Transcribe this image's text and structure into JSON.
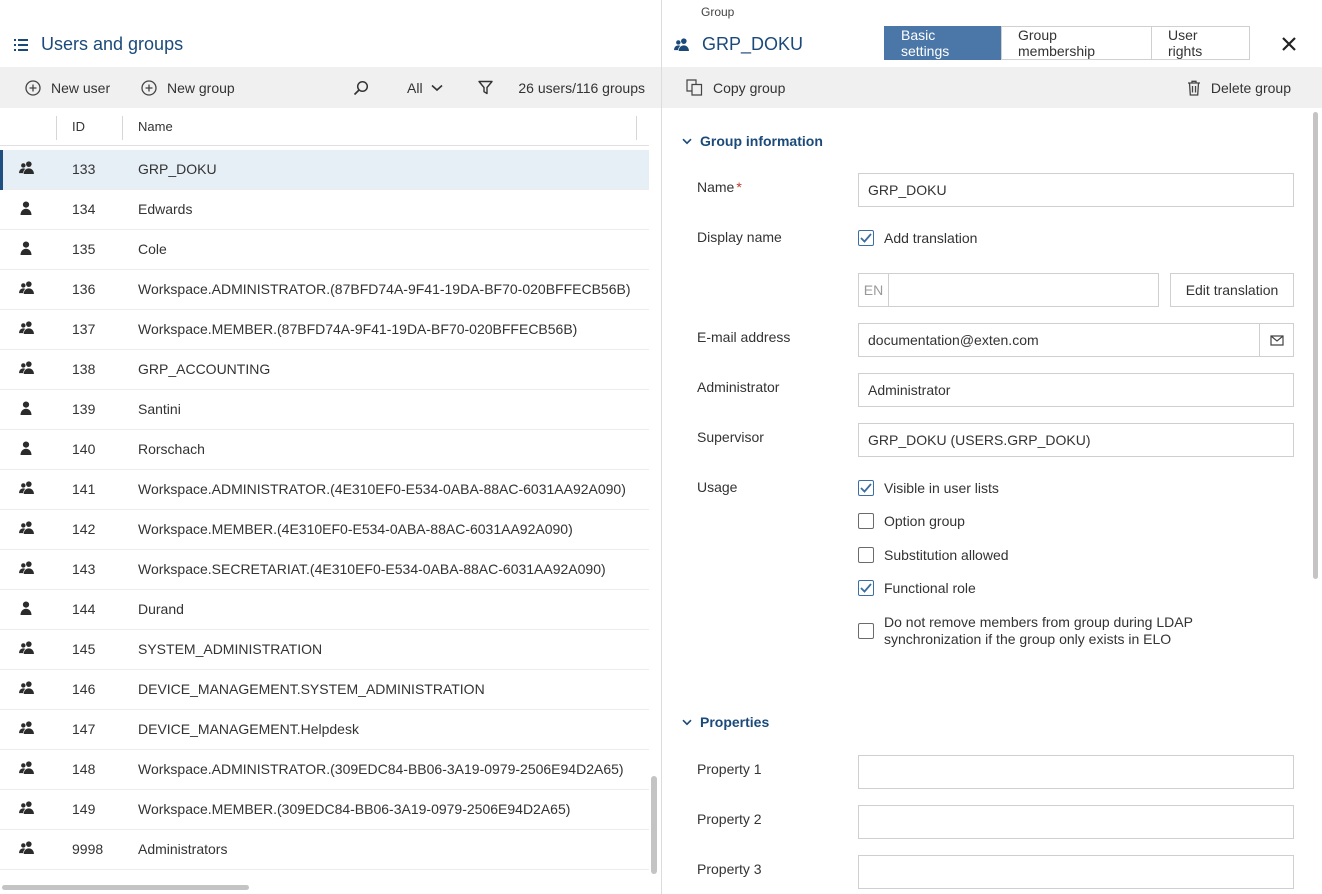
{
  "left": {
    "title": "Users and groups",
    "toolbar": {
      "new_user": "New user",
      "new_group": "New group",
      "filter_value": "All",
      "count": "26 users/116 groups"
    },
    "columns": {
      "id": "ID",
      "name": "Name"
    },
    "rows": [
      {
        "type": "group",
        "id": "133",
        "name": "GRP_DOKU",
        "selected": true
      },
      {
        "type": "user",
        "id": "134",
        "name": "Edwards"
      },
      {
        "type": "user",
        "id": "135",
        "name": "Cole"
      },
      {
        "type": "group",
        "id": "136",
        "name": "Workspace.ADMINISTRATOR.(87BFD74A-9F41-19DA-BF70-020BFFECB56B)"
      },
      {
        "type": "group",
        "id": "137",
        "name": "Workspace.MEMBER.(87BFD74A-9F41-19DA-BF70-020BFFECB56B)"
      },
      {
        "type": "group",
        "id": "138",
        "name": "GRP_ACCOUNTING"
      },
      {
        "type": "user",
        "id": "139",
        "name": "Santini"
      },
      {
        "type": "user",
        "id": "140",
        "name": "Rorschach"
      },
      {
        "type": "group",
        "id": "141",
        "name": "Workspace.ADMINISTRATOR.(4E310EF0-E534-0ABA-88AC-6031AA92A090)"
      },
      {
        "type": "group",
        "id": "142",
        "name": "Workspace.MEMBER.(4E310EF0-E534-0ABA-88AC-6031AA92A090)"
      },
      {
        "type": "group",
        "id": "143",
        "name": "Workspace.SECRETARIAT.(4E310EF0-E534-0ABA-88AC-6031AA92A090)"
      },
      {
        "type": "user",
        "id": "144",
        "name": "Durand"
      },
      {
        "type": "group",
        "id": "145",
        "name": "SYSTEM_ADMINISTRATION"
      },
      {
        "type": "group",
        "id": "146",
        "name": "DEVICE_MANAGEMENT.SYSTEM_ADMINISTRATION"
      },
      {
        "type": "group",
        "id": "147",
        "name": "DEVICE_MANAGEMENT.Helpdesk"
      },
      {
        "type": "group",
        "id": "148",
        "name": "Workspace.ADMINISTRATOR.(309EDC84-BB06-3A19-0979-2506E94D2A65)"
      },
      {
        "type": "group",
        "id": "149",
        "name": "Workspace.MEMBER.(309EDC84-BB06-3A19-0979-2506E94D2A65)"
      },
      {
        "type": "group",
        "id": "9998",
        "name": "Administrators"
      }
    ]
  },
  "right": {
    "subtitle": "Group",
    "title": "GRP_DOKU",
    "tabs": {
      "basic": "Basic settings",
      "membership": "Group membership",
      "rights": "User rights"
    },
    "toolbar": {
      "copy_group": "Copy group",
      "delete_group": "Delete group"
    },
    "group_info": {
      "heading": "Group information",
      "name_label": "Name",
      "required_mark": "*",
      "name_value": "GRP_DOKU",
      "display_name_label": "Display name",
      "add_translation": "Add translation",
      "lang_code": "EN",
      "edit_translation": "Edit translation",
      "email_label": "E-mail address",
      "email_value": "documentation@exten.com",
      "administrator_label": "Administrator",
      "administrator_value": "Administrator",
      "supervisor_label": "Supervisor",
      "supervisor_value": "GRP_DOKU (USERS.GRP_DOKU)",
      "usage_label": "Usage",
      "usage_options": {
        "visible": {
          "label": "Visible in user lists",
          "checked": true
        },
        "option_group": {
          "label": "Option group",
          "checked": false
        },
        "substitution": {
          "label": "Substitution allowed",
          "checked": false
        },
        "functional_role": {
          "label": "Functional role",
          "checked": true
        },
        "ldap_line1": "Do not remove members from group during LDAP",
        "ldap_line2": "synchronization if the group only exists in ELO",
        "ldap_checked": false
      }
    },
    "properties": {
      "heading": "Properties",
      "p1": "Property 1",
      "p2": "Property 2",
      "p3": "Property 3"
    }
  },
  "colors": {
    "accent": "#1b4a7a",
    "active_tab": "#4a77a8",
    "selection": "#e6eef6",
    "toolbar_bg": "#f0f0f0"
  },
  "icons": {
    "group": "group-icon",
    "user": "user-icon",
    "list": "list-icon",
    "search": "search-icon",
    "filter": "filter-icon",
    "close": "close-icon",
    "copy": "copy-icon",
    "trash": "trash-icon",
    "mail": "mail-icon"
  }
}
